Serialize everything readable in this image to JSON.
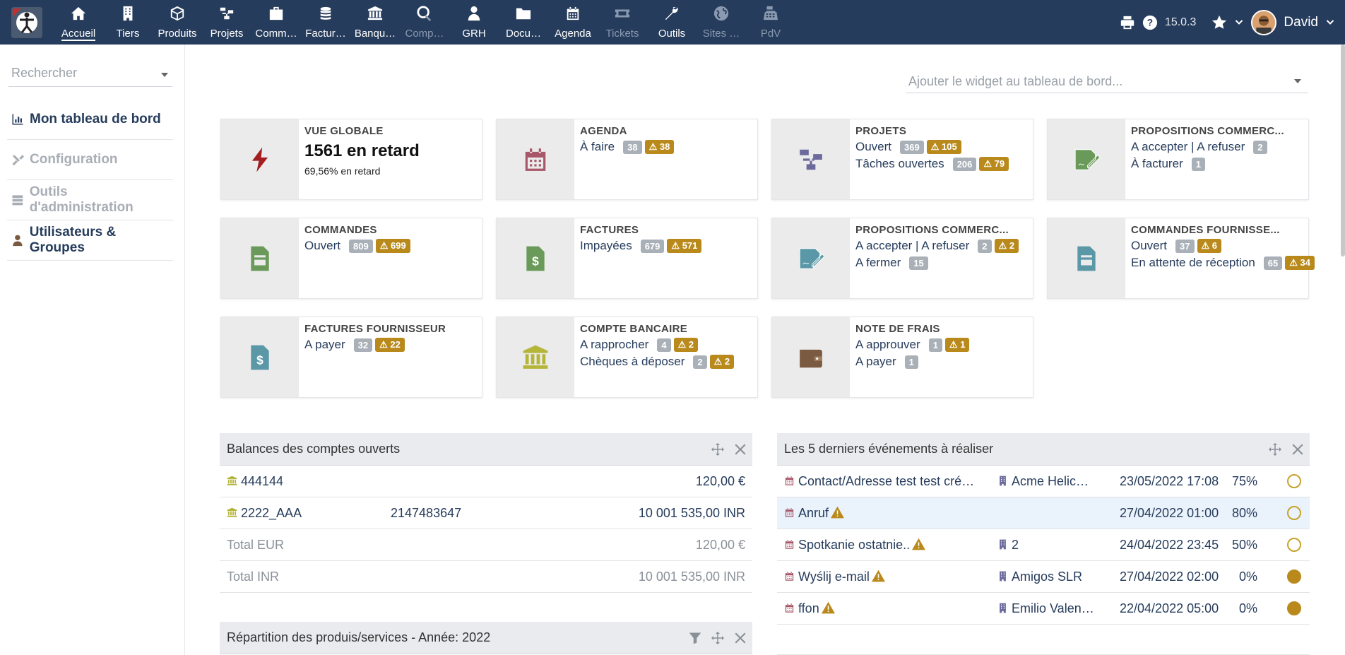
{
  "topbar": {
    "menu": [
      {
        "label": "Accueil",
        "icon": "home-icon",
        "dim": false,
        "active": true
      },
      {
        "label": "Tiers",
        "icon": "building-icon",
        "dim": false
      },
      {
        "label": "Produits",
        "icon": "cube-icon",
        "dim": false
      },
      {
        "label": "Projets",
        "icon": "project-icon",
        "dim": false
      },
      {
        "label": "Comm…",
        "icon": "briefcase-icon",
        "dim": false
      },
      {
        "label": "Factur…",
        "icon": "coins-icon",
        "dim": false
      },
      {
        "label": "Banqu…",
        "icon": "bank-icon",
        "dim": false
      },
      {
        "label": "Comp…",
        "icon": "search-dollar-icon",
        "dim": true
      },
      {
        "label": "GRH",
        "icon": "user-tie-icon",
        "dim": false
      },
      {
        "label": "Docu…",
        "icon": "folder-icon",
        "dim": false
      },
      {
        "label": "Agenda",
        "icon": "calendar-icon",
        "dim": false
      },
      {
        "label": "Tickets",
        "icon": "ticket-icon",
        "dim": true
      },
      {
        "label": "Outils",
        "icon": "wrench-icon",
        "dim": false
      },
      {
        "label": "Sites …",
        "icon": "globe-icon",
        "dim": true
      },
      {
        "label": "PdV",
        "icon": "cash-register-icon",
        "dim": true
      }
    ],
    "version": "15.0.3",
    "user": "David"
  },
  "sidebar": {
    "search_placeholder": "Rechercher",
    "items": [
      {
        "label": "Mon tableau de bord",
        "icon": "chart-icon",
        "dim": false
      },
      {
        "label": "Configuration",
        "icon": "tools-icon",
        "dim": true
      },
      {
        "label": "Outils d'administration",
        "icon": "server-icon",
        "dim": true
      },
      {
        "label": "Utilisateurs & Groupes",
        "icon": "user-icon",
        "dim": false
      }
    ]
  },
  "widget_select_placeholder": "Ajouter le widget au tableau de bord...",
  "colors": {
    "topbar": "#263c5c",
    "warn": "#b98a1b",
    "bolt": "#a31f1f",
    "agenda": "#a8566a",
    "project": "#6c6a9c",
    "propal": "#6a9a5a",
    "supplier": "#5a98a8",
    "bank": "#b5b53a",
    "wallet": "#7a5a40"
  },
  "boxes": {
    "global": {
      "title": "VUE GLOBALE",
      "big": "1561 en retard",
      "small": "69,56% en retard"
    },
    "agenda": {
      "title": "AGENDA",
      "l1": "À faire",
      "b1": "38",
      "w1": "38"
    },
    "projets": {
      "title": "PROJETS",
      "l1": "Ouvert",
      "b1": "369",
      "w1": "105",
      "l2": "Tâches ouvertes",
      "b2": "206",
      "w2": "79"
    },
    "propal1": {
      "title": "PROPOSITIONS COMMERC...",
      "l1": "A accepter | A refuser",
      "b1": "2",
      "l2": "À facturer",
      "b2": "1"
    },
    "commandes": {
      "title": "COMMANDES",
      "l1": "Ouvert",
      "b1": "809",
      "w1": "699"
    },
    "factures": {
      "title": "FACTURES",
      "l1": "Impayées",
      "b1": "679",
      "w1": "571"
    },
    "propal2": {
      "title": "PROPOSITIONS COMMERC...",
      "l1": "A accepter | A refuser",
      "b1": "2",
      "w1": "2",
      "l2": "A fermer",
      "b2": "15"
    },
    "cmdfourn": {
      "title": "COMMANDES FOURNISSE...",
      "l1": "Ouvert",
      "b1": "37",
      "w1": "6",
      "l2": "En attente de réception",
      "b2": "65",
      "w2": "34"
    },
    "factfourn": {
      "title": "FACTURES FOURNISSEUR",
      "l1": "A payer",
      "b1": "32",
      "w1": "22"
    },
    "banque": {
      "title": "COMPTE BANCAIRE",
      "l1": "A rapprocher",
      "b1": "4",
      "w1": "2",
      "l2": "Chèques à déposer",
      "b2": "2",
      "w2": "2"
    },
    "frais": {
      "title": "NOTE DE FRAIS",
      "l1": "A approuver",
      "b1": "1",
      "w1": "1",
      "l2": "A payer",
      "b2": "1"
    }
  },
  "balances": {
    "title": "Balances des comptes ouverts",
    "rows": [
      {
        "name": "444144",
        "num": "",
        "amount": "120,00 €"
      },
      {
        "name": "2222_AAA",
        "num": "2147483647",
        "amount": "10 001 535,00 INR"
      }
    ],
    "totals": [
      {
        "label": "Total EUR",
        "amount": "120,00 €"
      },
      {
        "label": "Total INR",
        "amount": "10 001 535,00 INR"
      }
    ]
  },
  "repartition": {
    "title": "Répartition des produis/services - Année: 2022"
  },
  "events": {
    "title": "Les 5 derniers événements à réaliser",
    "rows": [
      {
        "label": "Contact/Adresse test test cré…",
        "warn": false,
        "company": "Acme Helic…",
        "date": "23/05/2022 17:08",
        "pct": "75%",
        "full": false
      },
      {
        "label": "Anruf",
        "warn": true,
        "company": "",
        "date": "27/04/2022 01:00",
        "pct": "80%",
        "full": false
      },
      {
        "label": "Spotkanie ostatnie..",
        "warn": true,
        "company": "2",
        "date": "24/04/2022 23:45",
        "pct": "50%",
        "full": false
      },
      {
        "label": "Wyślij e-mail",
        "warn": true,
        "company": "Amigos SLR",
        "date": "27/04/2022 02:00",
        "pct": "0%",
        "full": true
      },
      {
        "label": "ffon",
        "warn": true,
        "company": "Emilio Valen…",
        "date": "22/04/2022 05:00",
        "pct": "0%",
        "full": true
      }
    ]
  }
}
